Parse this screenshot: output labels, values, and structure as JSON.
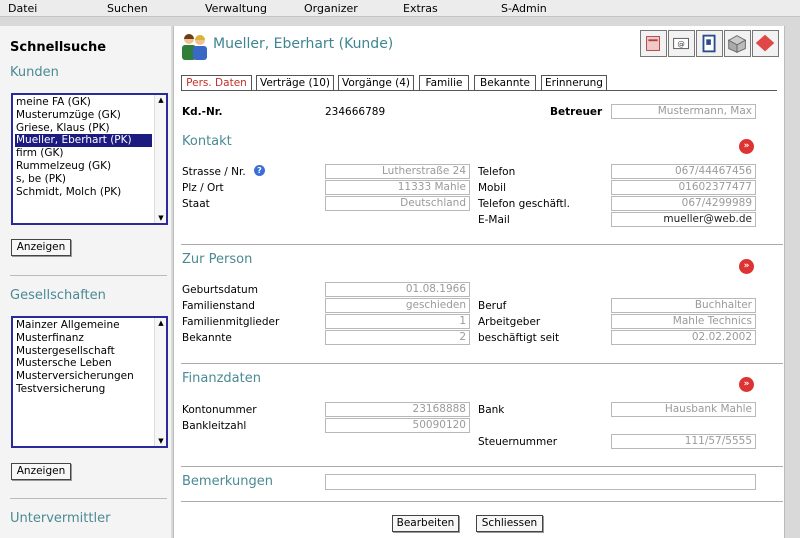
{
  "menu": [
    "Datei",
    "Suchen",
    "Verwaltung",
    "Organizer",
    "Extras",
    "S-Admin"
  ],
  "sidebar": {
    "title": "Schnellsuche",
    "kunden_label": "Kunden",
    "kunden_items": [
      "meine FA (GK)",
      "Musterumzüge (GK)",
      "Griese, Klaus (PK)",
      "Mueller, Eberhart (PK)",
      "firm (GK)",
      "Rummelzeug (GK)",
      "s, be (PK)",
      "Schmidt, Molch (PK)"
    ],
    "kunden_selected": 3,
    "show_button": "Anzeigen",
    "gesellschaften_label": "Gesellschaften",
    "gesellschaften_items": [
      "Mainzer Allgemeine",
      "Musterfinanz",
      "Mustergesellschaft",
      "Mustersche Leben",
      "Musterversicherungen",
      "Testversicherung"
    ],
    "show_button2": "Anzeigen",
    "untervermittler_label": "Untervermittler"
  },
  "header": {
    "title": "Mueller, Eberhart (Kunde)"
  },
  "tabs": [
    "Pers. Daten",
    "Verträge (10)",
    "Vorgänge (4)",
    "Familie",
    "Bekannte",
    "Erinnerung"
  ],
  "customer": {
    "kdnr_label": "Kd.-Nr.",
    "kdnr_value": "234666789",
    "betreuer_label": "Betreuer",
    "betreuer_value": "Mustermann, Max"
  },
  "kontakt": {
    "title": "Kontakt",
    "strasse_label": "Strasse / Nr.",
    "strasse_value": "Lutherstraße 24",
    "plz_label": "Plz / Ort",
    "plz_value": "11333 Mahle",
    "staat_label": "Staat",
    "staat_value": "Deutschland",
    "telefon_label": "Telefon",
    "telefon_value": "067/44467456",
    "mobil_label": "Mobil",
    "mobil_value": "01602377477",
    "telgesch_label": "Telefon geschäftl.",
    "telgesch_value": "067/4299989",
    "email_label": "E-Mail",
    "email_value": "mueller@web.de"
  },
  "person": {
    "title": "Zur Person",
    "geburt_label": "Geburtsdatum",
    "geburt_value": "01.08.1966",
    "familienstand_label": "Familienstand",
    "familienstand_value": "geschieden",
    "mitglieder_label": "Familienmitglieder",
    "mitglieder_value": "1",
    "bekannte_label": "Bekannte",
    "bekannte_value": "2",
    "beruf_label": "Beruf",
    "beruf_value": "Buchhalter",
    "arbeitgeber_label": "Arbeitgeber",
    "arbeitgeber_value": "Mahle Technics",
    "seit_label": "beschäftigt seit",
    "seit_value": "02.02.2002"
  },
  "finanz": {
    "title": "Finanzdaten",
    "konto_label": "Kontonummer",
    "konto_value": "23168888",
    "blz_label": "Bankleitzahl",
    "blz_value": "50090120",
    "bank_label": "Bank",
    "bank_value": "Hausbank Mahle",
    "steuer_label": "Steuernummer",
    "steuer_value": "111/57/5555"
  },
  "bemerkungen": {
    "title": "Bemerkungen",
    "value": ""
  },
  "buttons": {
    "edit": "Bearbeiten",
    "close": "Schliessen"
  },
  "colors": {
    "accent": "#4a8a94",
    "active_tab": "#c0302a",
    "selection": "#1c1c80"
  }
}
